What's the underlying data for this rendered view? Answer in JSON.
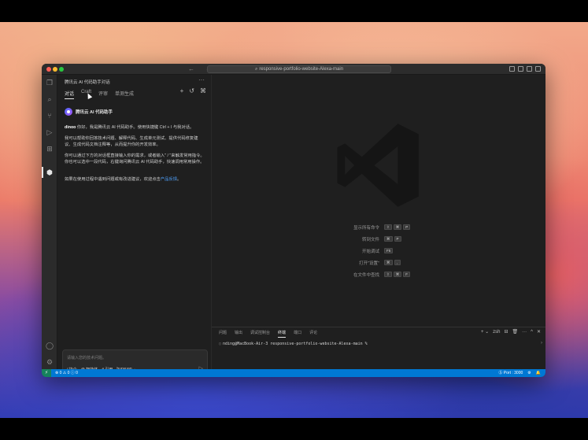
{
  "window": {
    "command_center": "responsive-portfolio-website-Alexa-main",
    "nav_arrows": "← →"
  },
  "sidebar": {
    "title": "腾讯云 AI 代码助手对话",
    "more": "···",
    "tabs": [
      "对话",
      "Craft",
      "评审",
      "单测生成"
    ],
    "actions": [
      "+",
      "↺",
      "⌘"
    ],
    "assistant_name": "腾讯云 AI 代码助手",
    "greeting_user": "dinoo",
    "greeting_rest": " 你好，我是腾讯云 AI 代码助手。使用快捷键 Ctrl + I 与我对话。",
    "msg2": "我可以帮助你回答技术问题、解释代码、生成单元测试、提供代码修复建议、生成代码文档注释等，从而提升你的开发效率。",
    "msg3": "你可以通过下方的对话框直接输入你的需求，或者输入\" / \"来触发常用指令。你也可以选中一段代码，右键询问腾讯云 AI 代码助手，快速调用常用操作。",
    "msg4_prefix": "如果在使用过程中遇到问题或有改进建议，欢迎点击",
    "msg4_link": "产品反馈",
    "msg4_suffix": "。",
    "chat_placeholder": "请输入您的技术问题。",
    "chat_tools": [
      "/ 指令",
      "@ 智能体",
      "# 引用",
      "hunyuan ⌄"
    ],
    "send_icon": "▷"
  },
  "editor": {
    "hints": [
      {
        "label": "显示所有命令",
        "keys": [
          "⇧",
          "⌘",
          "P"
        ]
      },
      {
        "label": "转到文件",
        "keys": [
          "⌘",
          "P"
        ]
      },
      {
        "label": "开始调试",
        "keys": [
          "F5"
        ]
      },
      {
        "label": "打开\"设置\"",
        "keys": [
          "⌘",
          ","
        ]
      },
      {
        "label": "在文件中查找",
        "keys": [
          "⇧",
          "⌘",
          "F"
        ]
      }
    ]
  },
  "panel": {
    "tabs": [
      "问题",
      "输出",
      "调试控制台",
      "终端",
      "端口",
      "评论"
    ],
    "active_tab": "终端",
    "tools": [
      "+ ⌄",
      "zsh",
      "⊟",
      "🗑",
      "···",
      "^",
      "✕"
    ],
    "terminal_line": "nding@MacBook-Air-3 responsive-portfolio-website-Alexa-main %"
  },
  "statusbar": {
    "remote": "⚡",
    "errors": "⊗ 0 ⚠ 0 ⓘ 0",
    "port": "Ⓢ Port : 3000",
    "right_icons": [
      "⚙",
      "🔔"
    ]
  },
  "colors": {
    "accent": "#0078d4",
    "link": "#4fa3ff"
  }
}
